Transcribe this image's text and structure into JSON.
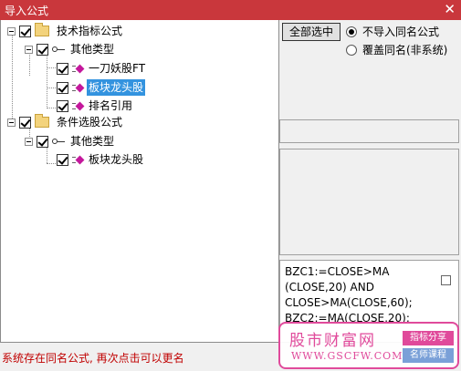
{
  "window": {
    "title": "导入公式",
    "close_glyph": "✕"
  },
  "tree": {
    "groups": [
      {
        "label": "技术指标公式",
        "checked": true,
        "categories": [
          {
            "label": "其他类型",
            "checked": true,
            "items": [
              {
                "label": "一刀妖股FT",
                "checked": true,
                "selected": false
              },
              {
                "label": "板块龙头股",
                "checked": true,
                "selected": true
              },
              {
                "label": "排名引用",
                "checked": true,
                "selected": false
              }
            ]
          }
        ]
      },
      {
        "label": "条件选股公式",
        "checked": true,
        "categories": [
          {
            "label": "其他类型",
            "checked": true,
            "items": [
              {
                "label": "板块龙头股",
                "checked": true,
                "selected": false
              }
            ]
          }
        ]
      }
    ]
  },
  "actions": {
    "select_all_label": "全部选中"
  },
  "options": [
    {
      "label": "不导入同名公式",
      "selected": true
    },
    {
      "label": "覆盖同名(非系统)",
      "selected": false
    }
  ],
  "formula_preview": "BZC1:=CLOSE>MA\n(CLOSE,20) AND\nCLOSE>MA(CLOSE,60);\nBZC2:=MA(CLOSE,20);",
  "status_text": "系统存在同名公式, 再次点击可以更名",
  "watermark": {
    "brand": "股市财富网",
    "url": "WWW.GSCFW.COM",
    "tag1": "指标分享",
    "tag2": "名师课程"
  },
  "colors": {
    "titlebar": "#c9373c",
    "selection": "#3393df",
    "status_text": "#c00000",
    "watermark_accent": "#e04a9b"
  }
}
